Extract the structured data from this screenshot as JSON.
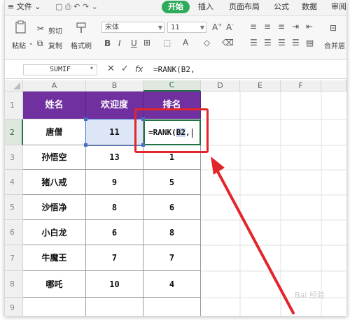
{
  "menu": {
    "file": "文件",
    "start": "开始",
    "insert": "插入",
    "page_layout": "页面布局",
    "formula": "公式",
    "data": "数据",
    "review": "审阅"
  },
  "ribbon": {
    "paste": "粘贴",
    "cut": "剪切",
    "copy": "复制",
    "format_painter": "格式刷",
    "font_name": "宋体",
    "font_size": "11",
    "merge_center": "合并居"
  },
  "formula_bar": {
    "name_box": "SUMIF",
    "cancel_icon": "✕",
    "confirm_icon": "✓",
    "fx": "fx",
    "content": "=RANK(B2,"
  },
  "columns": [
    "A",
    "B",
    "C",
    "D",
    "E",
    "F"
  ],
  "rows": [
    "1",
    "2",
    "3",
    "4",
    "5",
    "6",
    "7",
    "8",
    "9"
  ],
  "table": {
    "headers": [
      "姓名",
      "欢迎度",
      "排名"
    ],
    "data": [
      [
        "唐僧",
        "11",
        ""
      ],
      [
        "孙悟空",
        "13",
        "1"
      ],
      [
        "猪八戒",
        "9",
        "5"
      ],
      [
        "沙悟净",
        "8",
        "6"
      ],
      [
        "小白龙",
        "6",
        "8"
      ],
      [
        "牛魔王",
        "7",
        "7"
      ],
      [
        "哪吒",
        "10",
        "4"
      ],
      [
        "",
        "",
        ""
      ]
    ],
    "edit_cell": {
      "prefix": "=RANK(",
      "ref": "B2",
      "suffix": ","
    }
  },
  "watermark": "Bai 经验",
  "colors": {
    "header_fill": "#7030a0",
    "accent_green": "#207245",
    "start_tab": "#2eab5a",
    "annotation_red": "#e1252a",
    "selected_b2": "#dce6f7"
  }
}
